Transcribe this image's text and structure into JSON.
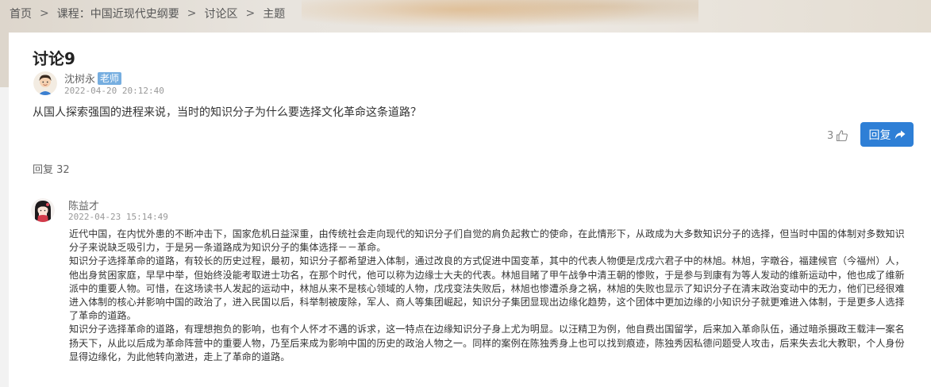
{
  "breadcrumb": {
    "items": [
      "首页",
      "课程：中国近现代史纲要",
      "讨论区",
      "主题"
    ],
    "separator": ">"
  },
  "topic": {
    "title": "讨论9",
    "author": "沈树永",
    "role_badge": "老师",
    "timestamp": "2022-04-20 20:12:40",
    "question": "从国人探索强国的进程来说，当时的知识分子为什么要选择文化革命这条道路？",
    "like_count": "3",
    "reply_button_label": "回复"
  },
  "replies_header": {
    "label": "回复 32"
  },
  "reply": {
    "author": "陈益才",
    "timestamp": "2022-04-23 15:14:49",
    "paragraphs": [
      "近代中国，在内忧外患的不断冲击下，国家危机日益深重，由传统社会走向现代的知识分子们自觉的肩负起救亡的使命，在此情形下，从政成为大多数知识分子的选择，但当时中国的体制对多数知识分子来说缺乏吸引力，于是另一条道路成为知识分子的集体选择－－革命。",
      "知识分子选择革命的道路，有较长的历史过程，最初，知识分子都希望进入体制，通过改良的方式促进中国变革，其中的代表人物便是戊戌六君子中的林旭。林旭，字暾谷，福建候官（今福州）人，他出身贫困家庭，早早中举，但始终没能考取进士功名，在那个时代，他可以称为边缘士大夫的代表。林旭目睹了甲午战争中清王朝的惨败，于是参与到康有为等人发动的维新运动中，他也成了维新派中的重要人物。可惜，在这场读书人发起的运动中，林旭从来不是核心领域的人物，戊戌变法失败后，林旭也惨遭杀身之祸，林旭的失败也显示了知识分子在清末政治变动中的无力，他们已经很难进入体制的核心并影响中国的政治了，进入民国以后，科举制被废除，军人、商人等集团崛起，知识分子集团显现出边缘化趋势，这个团体中更加边缘的小知识分子就更难进入体制，于是更多人选择了革命的道路。",
      "知识分子选择革命的道路，有理想抱负的影响，也有个人怀才不遇的诉求，这一特点在边缘知识分子身上尤为明显。以汪精卫为例，他自费出国留学，后来加入革命队伍，通过暗杀摄政王载沣一案名扬天下，从此以后成为革命阵营中的重要人物，乃至后来成为影响中国的历史的政治人物之一。同样的案例在陈独秀身上也可以找到痕迹，陈独秀因私德问题受人攻击，后来失去北大教职，个人身份显得边缘化，为此他转向激进，走上了革命的道路。"
    ]
  },
  "colors": {
    "accent": "#2e7fd6",
    "badge": "#76aee0"
  }
}
